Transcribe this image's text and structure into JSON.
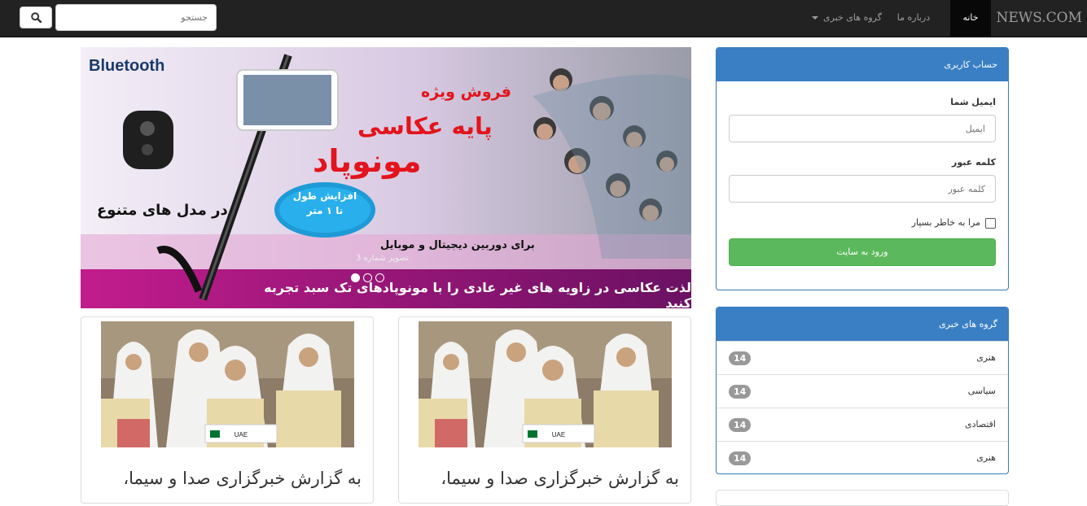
{
  "navbar": {
    "brand": "NEWS.COM",
    "home": "خانه",
    "about": "درباره ما",
    "groups": "گروه های خبری",
    "search_placeholder": "جستجو"
  },
  "carousel": {
    "logo_text": "Bluetooth",
    "headline_1": "فروش ویژه",
    "headline_2": "پایه عکاسی",
    "headline_3": "مونوپاد",
    "bubble_1": "افزایش طول",
    "bubble_2": "تا ۱ متر",
    "models": "در مدل های متنوع",
    "for_cameras": "برای دوربین دیجیتال و موبایل",
    "bottom_line": "لذت عکاسی در زاویه های غیر عادی را با مونوپادهای تک سبد تجربه کنید",
    "caption": "تصویر شماره 3",
    "active_index": 1,
    "slide_count": 3
  },
  "news_cards": [
    {
      "title": "به گزارش خبرگزاری صدا و سیما،",
      "badge": "UAE"
    },
    {
      "title": "به گزارش خبرگزاری صدا و سیما،",
      "badge": "UAE"
    }
  ],
  "login_panel": {
    "heading": "حساب کاربری",
    "email_label": "ایمیل شما",
    "email_placeholder": "ایمیل",
    "password_label": "کلمه عبور",
    "password_placeholder": "کلمه عبور",
    "remember_label": "مرا به خاطر بسپار",
    "submit": "ورود به سایت"
  },
  "groups_panel": {
    "heading": "گروه های خبری",
    "items": [
      {
        "label": "هنری",
        "count": "14"
      },
      {
        "label": "سیاسی",
        "count": "14"
      },
      {
        "label": "اقتصادی",
        "count": "14"
      },
      {
        "label": "هنری",
        "count": "14"
      }
    ]
  }
}
